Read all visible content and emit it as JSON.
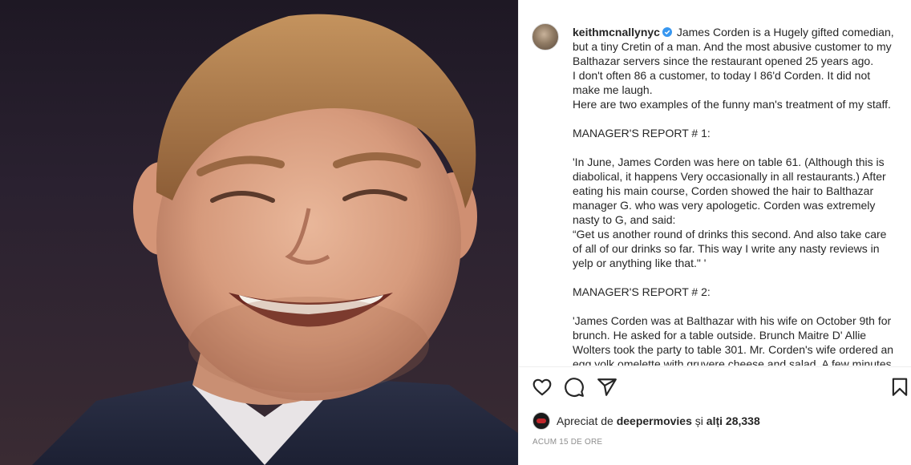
{
  "photo": {
    "alt_subject": "post-photo"
  },
  "post": {
    "username": "keithmcnallynyc",
    "caption_lines": [
      "James Corden is a Hugely gifted comedian,",
      "but a tiny Cretin of a man. And the most abusive customer to my",
      "Balthazar servers since the restaurant opened 25 years ago.",
      "I don't often 86 a customer, to today I 86'd Corden. It did not",
      "make me laugh.",
      "Here are two examples of the funny man's treatment of my staff.",
      "",
      "MANAGER'S REPORT # 1:",
      "",
      "'In June, James Corden was here on table 61. (Although this is",
      "diabolical, it happens Very occasionally in all restaurants.) After",
      "eating his main course, Corden showed the hair to Balthazar",
      "manager G. who was very apologetic. Corden was extremely",
      "nasty to G, and said:",
      "“Get us another round of drinks this second. And also take care",
      "of all of our drinks so far. This way I write any nasty reviews in",
      "yelp or anything like that.\" '",
      "",
      "MANAGER'S REPORT # 2:",
      "",
      "'James Corden was at Balthazar with his wife on October 9th for",
      "brunch. He asked for a table outside. Brunch Maitre D' Allie",
      "Wolters took the party to table 301. Mr. Corden's wife ordered an",
      "egg yolk omelette with gruyere cheese and salad. A few minutes"
    ]
  },
  "actions": {
    "like_icon": "heart-icon",
    "comment_icon": "comment-icon",
    "share_icon": "share-icon",
    "save_icon": "bookmark-icon"
  },
  "likes": {
    "prefix": "Apreciat de",
    "liker": "deepermovies",
    "joiner": "și",
    "others": "alți 28,338"
  },
  "timestamp": "ACUM 15 DE ORE",
  "colors": {
    "verified": "#3897f0",
    "text": "#262626",
    "muted": "#8e8e8e"
  }
}
